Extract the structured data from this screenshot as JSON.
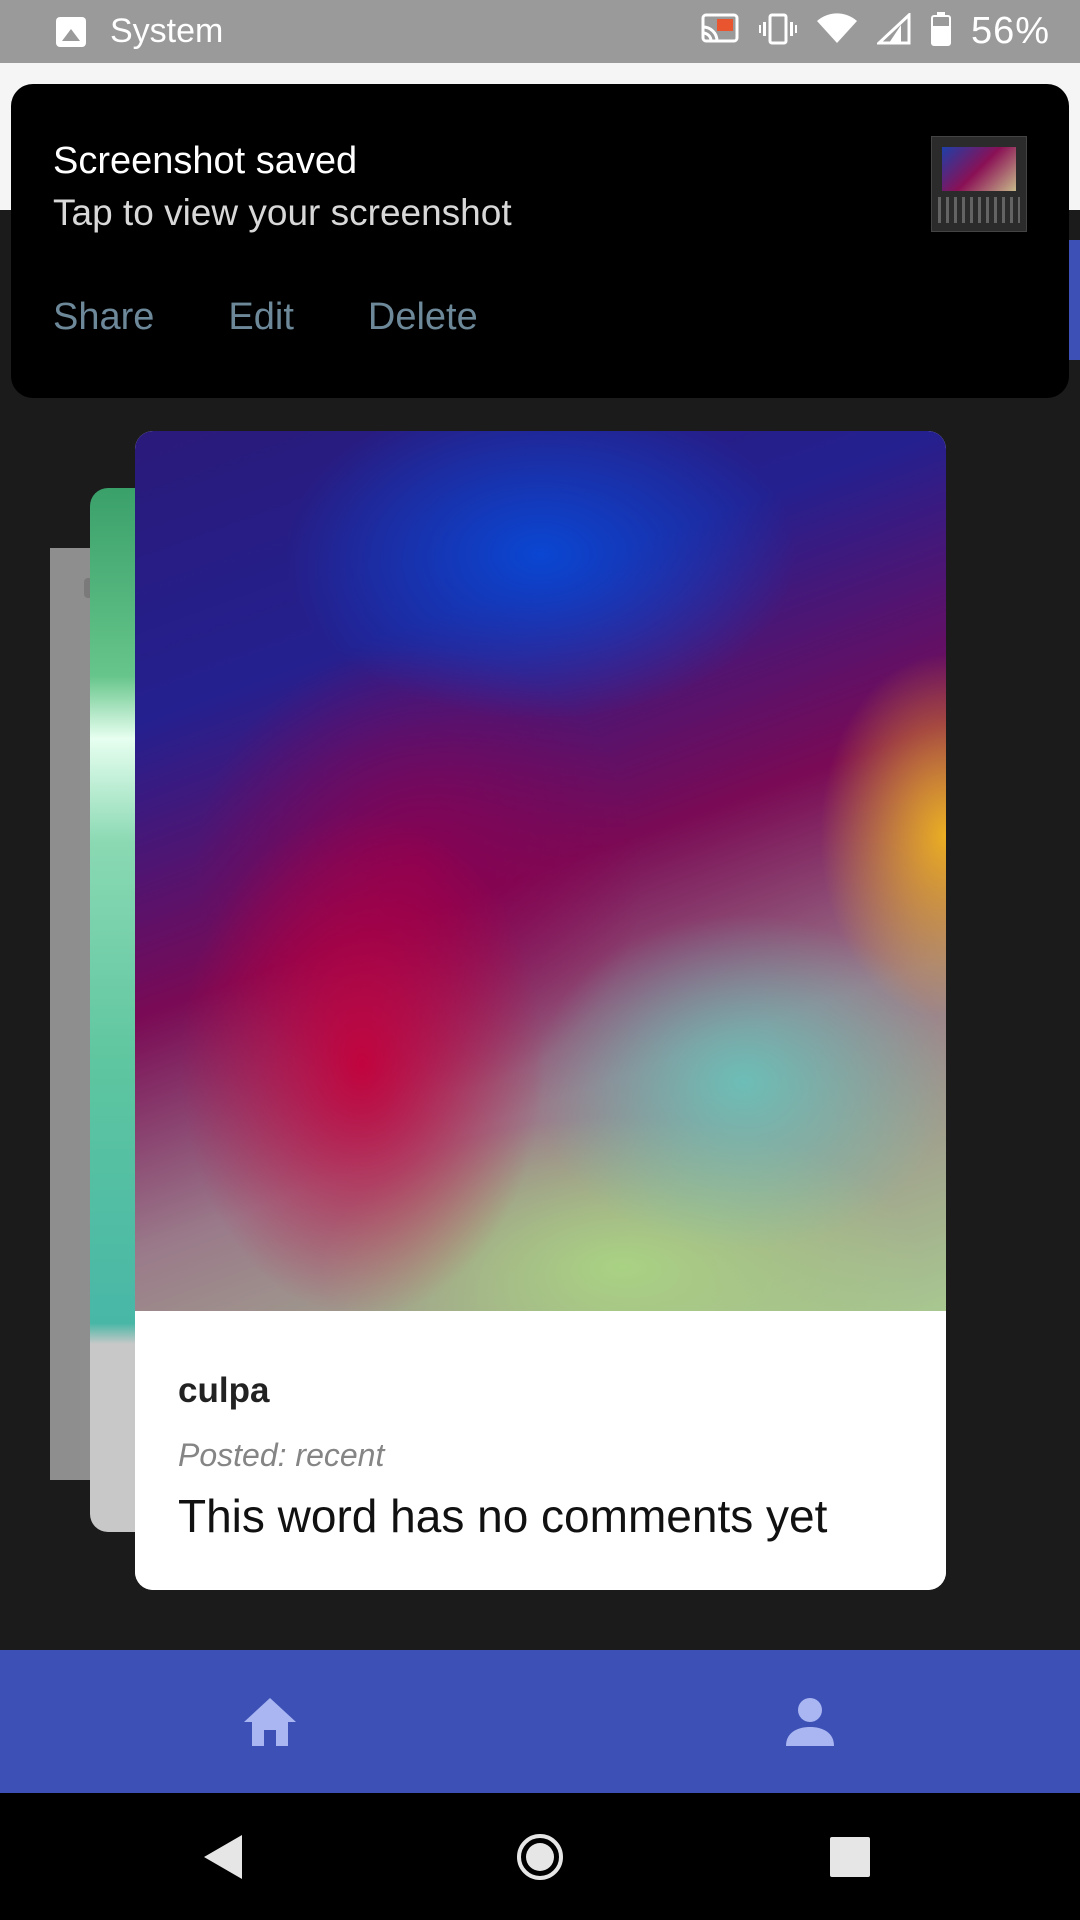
{
  "status_bar": {
    "app_name": "System",
    "battery_percent": "56%",
    "icons": [
      "image-icon",
      "cast-icon",
      "vibrate-icon",
      "wifi-icon",
      "signal-icon",
      "battery-icon"
    ]
  },
  "notification": {
    "title": "Screenshot saved",
    "subtitle": "Tap to view your screenshot",
    "actions": {
      "share": "Share",
      "edit": "Edit",
      "delete": "Delete"
    },
    "action_color": "#6c8899"
  },
  "card": {
    "word": "culpa",
    "posted": "Posted: recent",
    "comment": "This word has no comments yet"
  },
  "bottom_nav": {
    "items": [
      "home-icon",
      "person-icon"
    ],
    "background": "#3d50b6",
    "icon_color": "#a9b6f2"
  },
  "system_nav": {
    "buttons": [
      "back-icon",
      "home-circle-icon",
      "recents-icon"
    ]
  }
}
